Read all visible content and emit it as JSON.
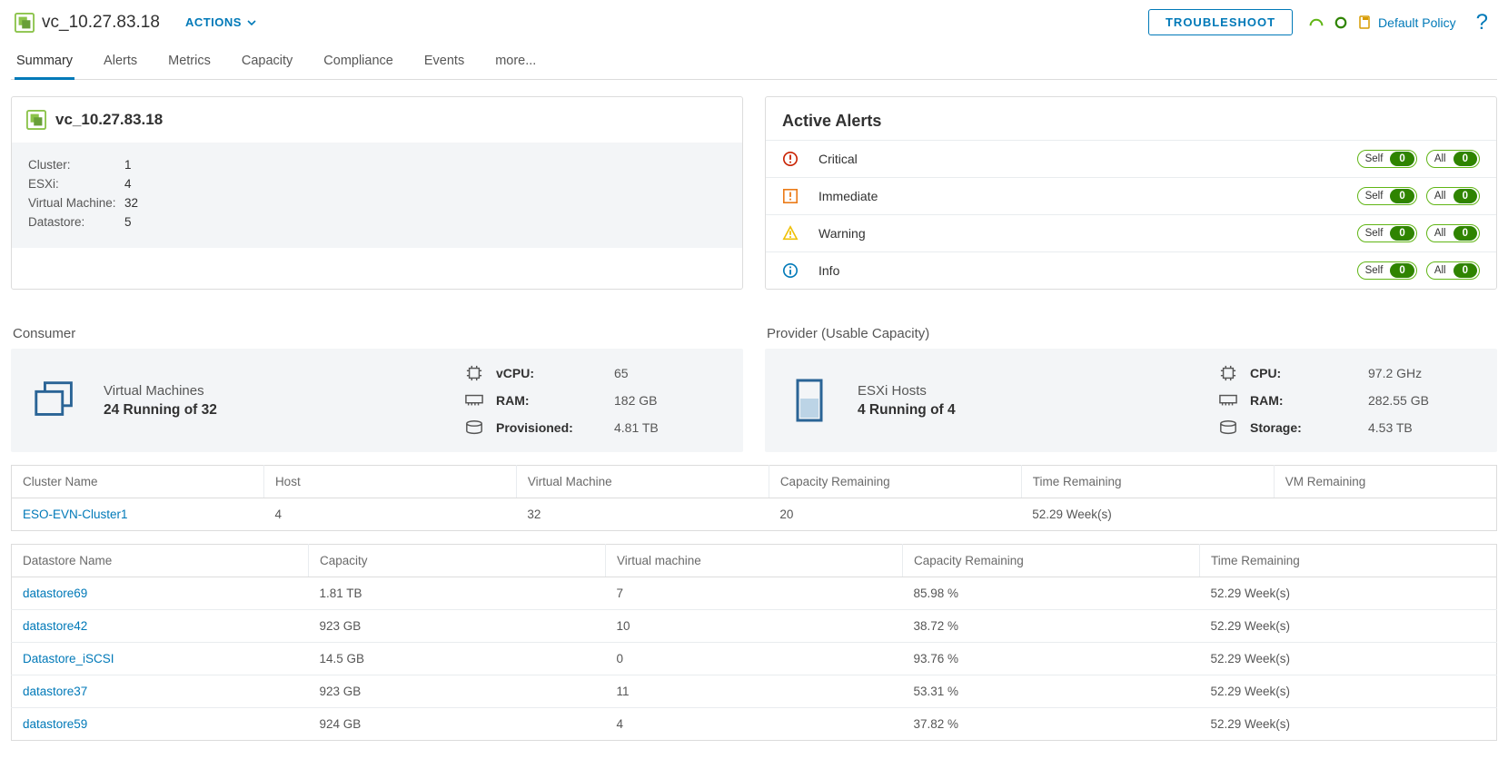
{
  "header": {
    "title": "vc_10.27.83.18",
    "actions_label": "ACTIONS",
    "troubleshoot_label": "TROUBLESHOOT",
    "default_policy_label": "Default Policy",
    "help_label": "?"
  },
  "tabs": {
    "items": [
      "Summary",
      "Alerts",
      "Metrics",
      "Capacity",
      "Compliance",
      "Events",
      "more..."
    ],
    "active_index": 0
  },
  "summary_card": {
    "title": "vc_10.27.83.18",
    "stats": {
      "cluster_label": "Cluster:",
      "cluster_value": "1",
      "esxi_label": "ESXi:",
      "esxi_value": "4",
      "vm_label": "Virtual Machine:",
      "vm_value": "32",
      "datastore_label": "Datastore:",
      "datastore_value": "5"
    }
  },
  "active_alerts": {
    "title": "Active Alerts",
    "self_label": "Self",
    "all_label": "All",
    "rows": [
      {
        "label": "Critical",
        "self": 0,
        "all": 0
      },
      {
        "label": "Immediate",
        "self": 0,
        "all": 0
      },
      {
        "label": "Warning",
        "self": 0,
        "all": 0
      },
      {
        "label": "Info",
        "self": 0,
        "all": 0
      }
    ]
  },
  "consumer": {
    "section_title": "Consumer",
    "heading": "Virtual Machines",
    "sub": "24 Running of 32",
    "metrics": {
      "vcpu_label": "vCPU:",
      "vcpu_value": "65",
      "ram_label": "RAM:",
      "ram_value": "182 GB",
      "prov_label": "Provisioned:",
      "prov_value": "4.81 TB"
    }
  },
  "provider": {
    "section_title": "Provider (Usable Capacity)",
    "heading": "ESXi Hosts",
    "sub": "4 Running of 4",
    "metrics": {
      "cpu_label": "CPU:",
      "cpu_value": "97.2 GHz",
      "ram_label": "RAM:",
      "ram_value": "282.55 GB",
      "storage_label": "Storage:",
      "storage_value": "4.53 TB"
    }
  },
  "cluster_table": {
    "headers": [
      "Cluster Name",
      "Host",
      "Virtual Machine",
      "Capacity Remaining",
      "Time Remaining",
      "VM Remaining"
    ],
    "rows": [
      {
        "name": "ESO-EVN-Cluster1",
        "host": "4",
        "vm": "32",
        "cap": "20",
        "time": "52.29 Week(s)",
        "vmrem": ""
      }
    ]
  },
  "datastore_table": {
    "headers": [
      "Datastore Name",
      "Capacity",
      "Virtual machine",
      "Capacity Remaining",
      "Time Remaining"
    ],
    "rows": [
      {
        "name": "datastore69",
        "cap": "1.81 TB",
        "vm": "7",
        "caprem": "85.98 %",
        "time": "52.29 Week(s)"
      },
      {
        "name": "datastore42",
        "cap": "923 GB",
        "vm": "10",
        "caprem": "38.72 %",
        "time": "52.29 Week(s)"
      },
      {
        "name": "Datastore_iSCSI",
        "cap": "14.5 GB",
        "vm": "0",
        "caprem": "93.76 %",
        "time": "52.29 Week(s)"
      },
      {
        "name": "datastore37",
        "cap": "923 GB",
        "vm": "11",
        "caprem": "53.31 %",
        "time": "52.29 Week(s)"
      },
      {
        "name": "datastore59",
        "cap": "924 GB",
        "vm": "4",
        "caprem": "37.82 %",
        "time": "52.29 Week(s)"
      }
    ]
  }
}
